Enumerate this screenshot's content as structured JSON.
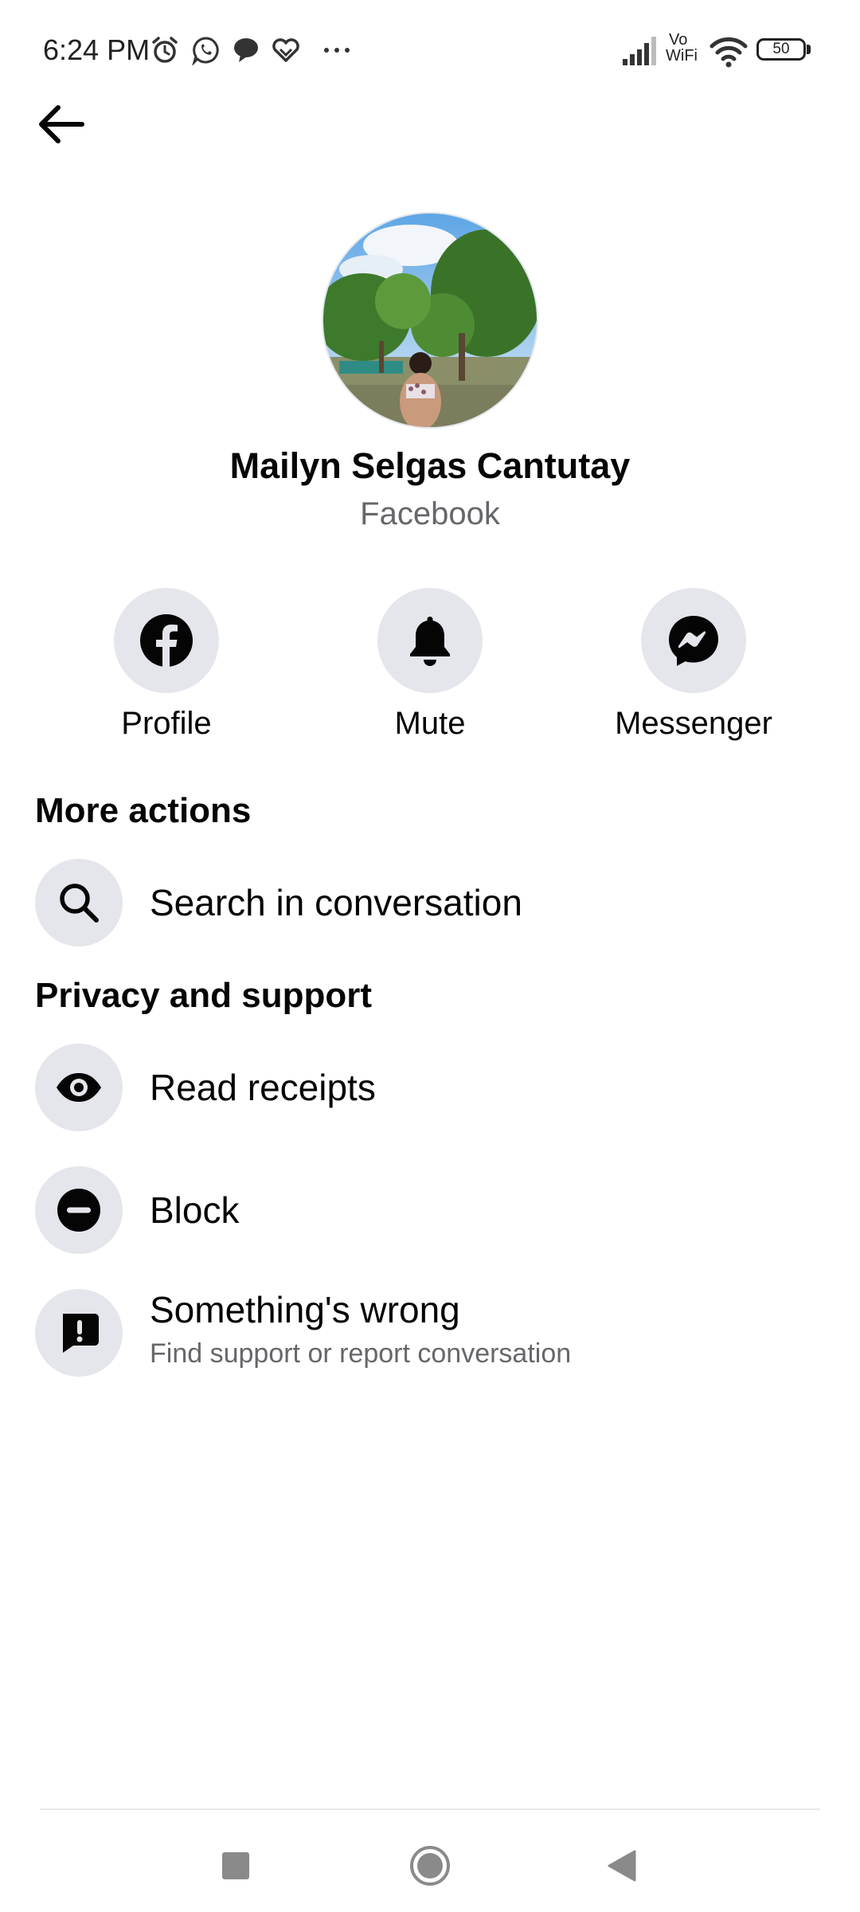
{
  "status_bar": {
    "time": "6:24 PM",
    "vowifi_top": "Vo",
    "vowifi_bottom": "WiFi",
    "battery": "50",
    "left_icons": [
      "alarm-icon",
      "whatsapp-icon",
      "chat-bubble-icon",
      "hearts-icon",
      "more-dots-icon"
    ],
    "right_icons": [
      "signal-icon",
      "wifi-icon",
      "battery-icon"
    ]
  },
  "header": {
    "back_icon": "arrow-left-icon"
  },
  "profile": {
    "name": "Mailyn Selgas Cantutay",
    "source": "Facebook"
  },
  "quick_actions": [
    {
      "label": "Profile",
      "icon": "facebook-icon"
    },
    {
      "label": "Mute",
      "icon": "bell-icon"
    },
    {
      "label": "Messenger",
      "icon": "messenger-icon"
    }
  ],
  "more_actions": {
    "heading": "More actions",
    "items": [
      {
        "label": "Search in conversation",
        "icon": "search-icon"
      }
    ]
  },
  "privacy_support": {
    "heading": "Privacy and support",
    "items": [
      {
        "label": "Read receipts",
        "icon": "eye-icon"
      },
      {
        "label": "Block",
        "icon": "block-icon"
      },
      {
        "label": "Something's wrong",
        "sublabel": "Find support or report conversation",
        "icon": "report-icon"
      }
    ]
  },
  "nav_bar": {
    "buttons": [
      "recents-square-icon",
      "home-circle-icon",
      "back-triangle-icon"
    ]
  },
  "colors": {
    "icon_background": "#e4e6eb",
    "secondary_text": "#65676b",
    "primary_text": "#050505"
  }
}
